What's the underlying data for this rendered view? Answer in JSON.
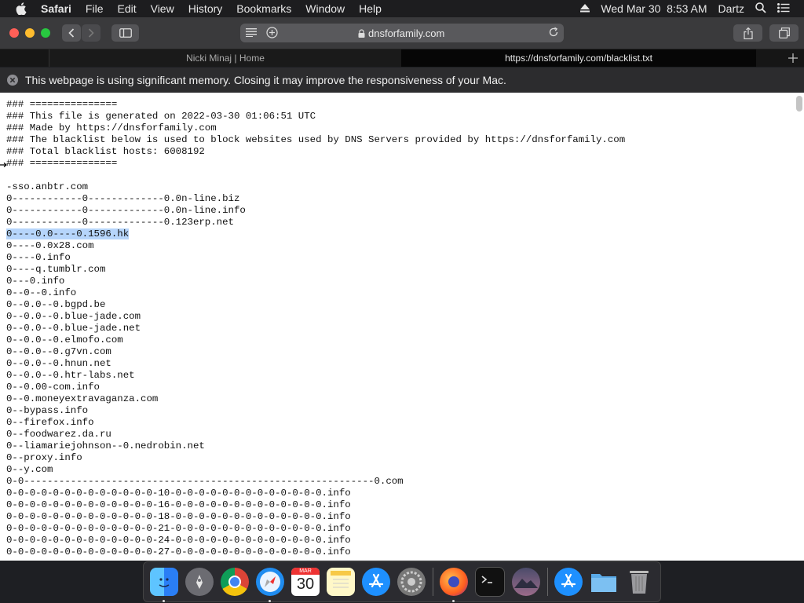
{
  "menubar": {
    "app_name": "Safari",
    "menus": [
      "File",
      "Edit",
      "View",
      "History",
      "Bookmarks",
      "Window",
      "Help"
    ],
    "datetime": "Wed Mar 30  8:53 AM",
    "user": "Dartz"
  },
  "toolbar": {
    "url_domain": "dnsforfamily.com"
  },
  "tabs": [
    {
      "label": "Nicki Minaj | Home",
      "active": false
    },
    {
      "label": "https://dnsforfamily.com/blacklist.txt",
      "active": true
    }
  ],
  "banner": {
    "message": "This webpage is using significant memory. Closing it may improve the responsiveness of your Mac."
  },
  "document": {
    "lines": [
      "### ===============",
      "### This file is generated on 2022-03-30 01:06:51 UTC",
      "### Made by https://dnsforfamily.com",
      "### The blacklist below is used to block websites used by DNS Servers provided by https://dnsforfamily.com",
      "### Total blacklist hosts: 6008192",
      "### ===============",
      "",
      "-sso.anbtr.com",
      "0------------0-------------0.0n-line.biz",
      "0------------0-------------0.0n-line.info",
      "0------------0-------------0.123erp.net",
      "0----0.0----0.1596.hk",
      "0----0.0x28.com",
      "0----0.info",
      "0----q.tumblr.com",
      "0---0.info",
      "0--0--0.info",
      "0--0.0--0.bgpd.be",
      "0--0.0--0.blue-jade.com",
      "0--0.0--0.blue-jade.net",
      "0--0.0--0.elmofo.com",
      "0--0.0--0.g7vn.com",
      "0--0.0--0.hnun.net",
      "0--0.0--0.htr-labs.net",
      "0--0.00-com.info",
      "0--0.moneyextravaganza.com",
      "0--bypass.info",
      "0--firefox.info",
      "0--foodwarez.da.ru",
      "0--liamariejohnson--0.nedrobin.net",
      "0--proxy.info",
      "0--y.com",
      "0-0------------------------------------------------------------0.com",
      "0-0-0-0-0-0-0-0-0-0-0-0-0-10-0-0-0-0-0-0-0-0-0-0-0-0-0.info",
      "0-0-0-0-0-0-0-0-0-0-0-0-0-16-0-0-0-0-0-0-0-0-0-0-0-0-0.info",
      "0-0-0-0-0-0-0-0-0-0-0-0-0-18-0-0-0-0-0-0-0-0-0-0-0-0-0.info",
      "0-0-0-0-0-0-0-0-0-0-0-0-0-21-0-0-0-0-0-0-0-0-0-0-0-0-0.info",
      "0-0-0-0-0-0-0-0-0-0-0-0-0-24-0-0-0-0-0-0-0-0-0-0-0-0-0.info",
      "0-0-0-0-0-0-0-0-0-0-0-0-0-27-0-0-0-0-0-0-0-0-0-0-0-0-0.info"
    ],
    "highlighted_line": "0----0.0----0.1596.hk"
  },
  "dock": {
    "calendar_month": "MAR",
    "calendar_day": "30",
    "items": [
      "finder-icon",
      "launchpad-icon",
      "chrome-icon",
      "safari-icon",
      "calendar-icon",
      "notes-icon",
      "app-store-icon",
      "system-preferences-icon",
      "firefox-icon",
      "terminal-icon",
      "macos-installer-icon",
      "app-store-downloads-icon",
      "folder-icon",
      "trash-icon"
    ]
  },
  "colors": {
    "menubar_bg": "#1d1d1f",
    "toolbar_bg": "#3a3a3c",
    "selection": "#b6d5fb",
    "close": "#ff5f57",
    "minimize": "#febc2e",
    "zoom": "#28c840"
  }
}
